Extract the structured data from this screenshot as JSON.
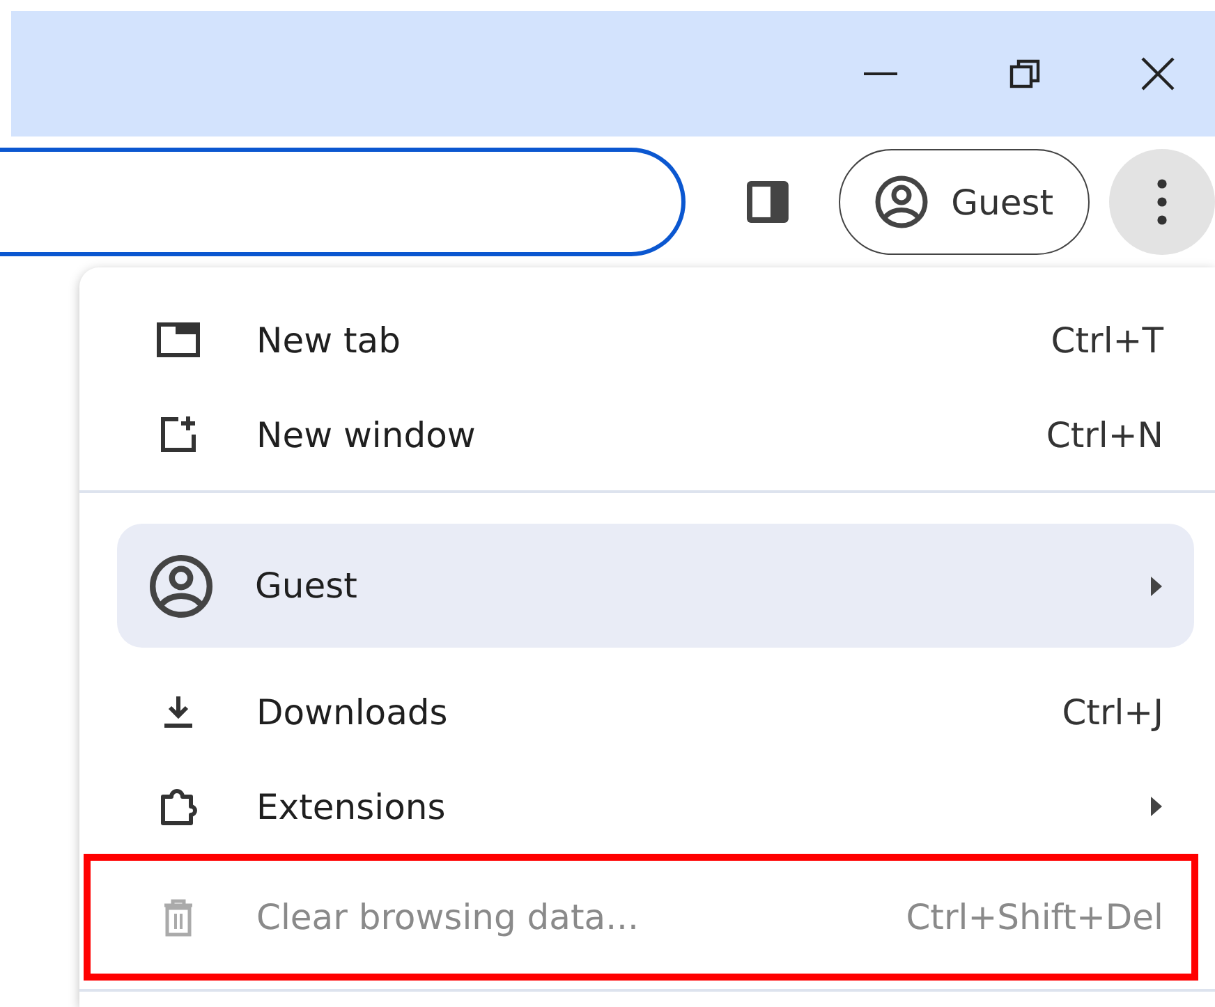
{
  "window": {
    "controls": [
      {
        "kind": "minimize"
      },
      {
        "kind": "restore"
      },
      {
        "kind": "close"
      }
    ]
  },
  "toolbar": {
    "profile_button": {
      "label": "Guest"
    }
  },
  "menu": {
    "items": [
      {
        "kind": "item",
        "label": "New tab",
        "shortcut": "Ctrl+T",
        "submenu": false,
        "hovered": false,
        "disabled": false,
        "highlighted": false
      },
      {
        "kind": "item",
        "label": "New window",
        "shortcut": "Ctrl+N",
        "submenu": false,
        "hovered": false,
        "disabled": false,
        "highlighted": false
      },
      {
        "kind": "separator"
      },
      {
        "kind": "profile",
        "label": "Guest",
        "submenu": true,
        "hovered": true,
        "disabled": false,
        "highlighted": false
      },
      {
        "kind": "item",
        "label": "Downloads",
        "shortcut": "Ctrl+J",
        "submenu": false,
        "hovered": false,
        "disabled": false,
        "highlighted": false
      },
      {
        "kind": "item",
        "label": "Extensions",
        "submenu": true,
        "hovered": false,
        "disabled": false,
        "highlighted": false
      },
      {
        "kind": "item",
        "label": "Clear browsing data...",
        "shortcut": "Ctrl+Shift+Del",
        "submenu": false,
        "hovered": false,
        "disabled": true,
        "highlighted": true
      },
      {
        "kind": "separator"
      }
    ]
  }
}
